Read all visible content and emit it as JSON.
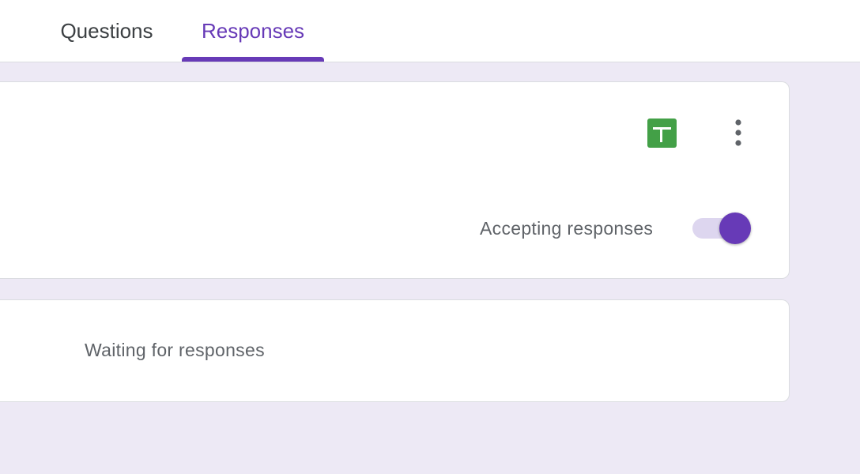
{
  "tabs": {
    "questions_label": "Questions",
    "responses_label": "Responses",
    "active": "Responses"
  },
  "summary": {
    "sheets_icon": "google-sheets-icon",
    "more_icon": "more-vert-icon",
    "accepting_label": "Accepting responses",
    "accepting_on": true
  },
  "waiting": {
    "text": "Waiting for responses"
  },
  "colors": {
    "accent": "#673ab7",
    "background": "#ede9f5",
    "sheets_green": "#43a047"
  }
}
